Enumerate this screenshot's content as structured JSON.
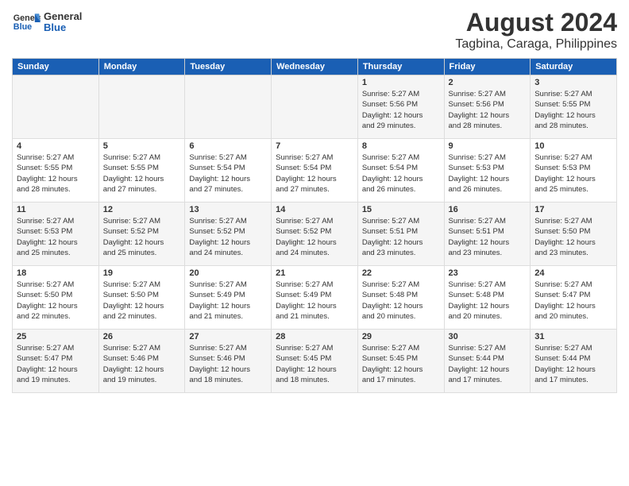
{
  "header": {
    "logo_line1": "General",
    "logo_line2": "Blue",
    "title": "August 2024",
    "subtitle": "Tagbina, Caraga, Philippines"
  },
  "days_of_week": [
    "Sunday",
    "Monday",
    "Tuesday",
    "Wednesday",
    "Thursday",
    "Friday",
    "Saturday"
  ],
  "weeks": [
    [
      {
        "day": "",
        "sunrise": "",
        "sunset": "",
        "daylight": ""
      },
      {
        "day": "",
        "sunrise": "",
        "sunset": "",
        "daylight": ""
      },
      {
        "day": "",
        "sunrise": "",
        "sunset": "",
        "daylight": ""
      },
      {
        "day": "",
        "sunrise": "",
        "sunset": "",
        "daylight": ""
      },
      {
        "day": "1",
        "sunrise": "5:27 AM",
        "sunset": "5:56 PM",
        "daylight": "12 hours and 29 minutes."
      },
      {
        "day": "2",
        "sunrise": "5:27 AM",
        "sunset": "5:56 PM",
        "daylight": "12 hours and 28 minutes."
      },
      {
        "day": "3",
        "sunrise": "5:27 AM",
        "sunset": "5:55 PM",
        "daylight": "12 hours and 28 minutes."
      }
    ],
    [
      {
        "day": "4",
        "sunrise": "5:27 AM",
        "sunset": "5:55 PM",
        "daylight": "12 hours and 28 minutes."
      },
      {
        "day": "5",
        "sunrise": "5:27 AM",
        "sunset": "5:55 PM",
        "daylight": "12 hours and 27 minutes."
      },
      {
        "day": "6",
        "sunrise": "5:27 AM",
        "sunset": "5:54 PM",
        "daylight": "12 hours and 27 minutes."
      },
      {
        "day": "7",
        "sunrise": "5:27 AM",
        "sunset": "5:54 PM",
        "daylight": "12 hours and 27 minutes."
      },
      {
        "day": "8",
        "sunrise": "5:27 AM",
        "sunset": "5:54 PM",
        "daylight": "12 hours and 26 minutes."
      },
      {
        "day": "9",
        "sunrise": "5:27 AM",
        "sunset": "5:53 PM",
        "daylight": "12 hours and 26 minutes."
      },
      {
        "day": "10",
        "sunrise": "5:27 AM",
        "sunset": "5:53 PM",
        "daylight": "12 hours and 25 minutes."
      }
    ],
    [
      {
        "day": "11",
        "sunrise": "5:27 AM",
        "sunset": "5:53 PM",
        "daylight": "12 hours and 25 minutes."
      },
      {
        "day": "12",
        "sunrise": "5:27 AM",
        "sunset": "5:52 PM",
        "daylight": "12 hours and 25 minutes."
      },
      {
        "day": "13",
        "sunrise": "5:27 AM",
        "sunset": "5:52 PM",
        "daylight": "12 hours and 24 minutes."
      },
      {
        "day": "14",
        "sunrise": "5:27 AM",
        "sunset": "5:52 PM",
        "daylight": "12 hours and 24 minutes."
      },
      {
        "day": "15",
        "sunrise": "5:27 AM",
        "sunset": "5:51 PM",
        "daylight": "12 hours and 23 minutes."
      },
      {
        "day": "16",
        "sunrise": "5:27 AM",
        "sunset": "5:51 PM",
        "daylight": "12 hours and 23 minutes."
      },
      {
        "day": "17",
        "sunrise": "5:27 AM",
        "sunset": "5:50 PM",
        "daylight": "12 hours and 23 minutes."
      }
    ],
    [
      {
        "day": "18",
        "sunrise": "5:27 AM",
        "sunset": "5:50 PM",
        "daylight": "12 hours and 22 minutes."
      },
      {
        "day": "19",
        "sunrise": "5:27 AM",
        "sunset": "5:50 PM",
        "daylight": "12 hours and 22 minutes."
      },
      {
        "day": "20",
        "sunrise": "5:27 AM",
        "sunset": "5:49 PM",
        "daylight": "12 hours and 21 minutes."
      },
      {
        "day": "21",
        "sunrise": "5:27 AM",
        "sunset": "5:49 PM",
        "daylight": "12 hours and 21 minutes."
      },
      {
        "day": "22",
        "sunrise": "5:27 AM",
        "sunset": "5:48 PM",
        "daylight": "12 hours and 20 minutes."
      },
      {
        "day": "23",
        "sunrise": "5:27 AM",
        "sunset": "5:48 PM",
        "daylight": "12 hours and 20 minutes."
      },
      {
        "day": "24",
        "sunrise": "5:27 AM",
        "sunset": "5:47 PM",
        "daylight": "12 hours and 20 minutes."
      }
    ],
    [
      {
        "day": "25",
        "sunrise": "5:27 AM",
        "sunset": "5:47 PM",
        "daylight": "12 hours and 19 minutes."
      },
      {
        "day": "26",
        "sunrise": "5:27 AM",
        "sunset": "5:46 PM",
        "daylight": "12 hours and 19 minutes."
      },
      {
        "day": "27",
        "sunrise": "5:27 AM",
        "sunset": "5:46 PM",
        "daylight": "12 hours and 18 minutes."
      },
      {
        "day": "28",
        "sunrise": "5:27 AM",
        "sunset": "5:45 PM",
        "daylight": "12 hours and 18 minutes."
      },
      {
        "day": "29",
        "sunrise": "5:27 AM",
        "sunset": "5:45 PM",
        "daylight": "12 hours and 17 minutes."
      },
      {
        "day": "30",
        "sunrise": "5:27 AM",
        "sunset": "5:44 PM",
        "daylight": "12 hours and 17 minutes."
      },
      {
        "day": "31",
        "sunrise": "5:27 AM",
        "sunset": "5:44 PM",
        "daylight": "12 hours and 17 minutes."
      }
    ]
  ],
  "labels": {
    "sunrise": "Sunrise:",
    "sunset": "Sunset:",
    "daylight": "Daylight:"
  },
  "colors": {
    "header_bg": "#1a5fb4",
    "header_text": "#ffffff",
    "odd_row": "#f5f5f5",
    "even_row": "#ffffff",
    "border": "#dddddd"
  }
}
